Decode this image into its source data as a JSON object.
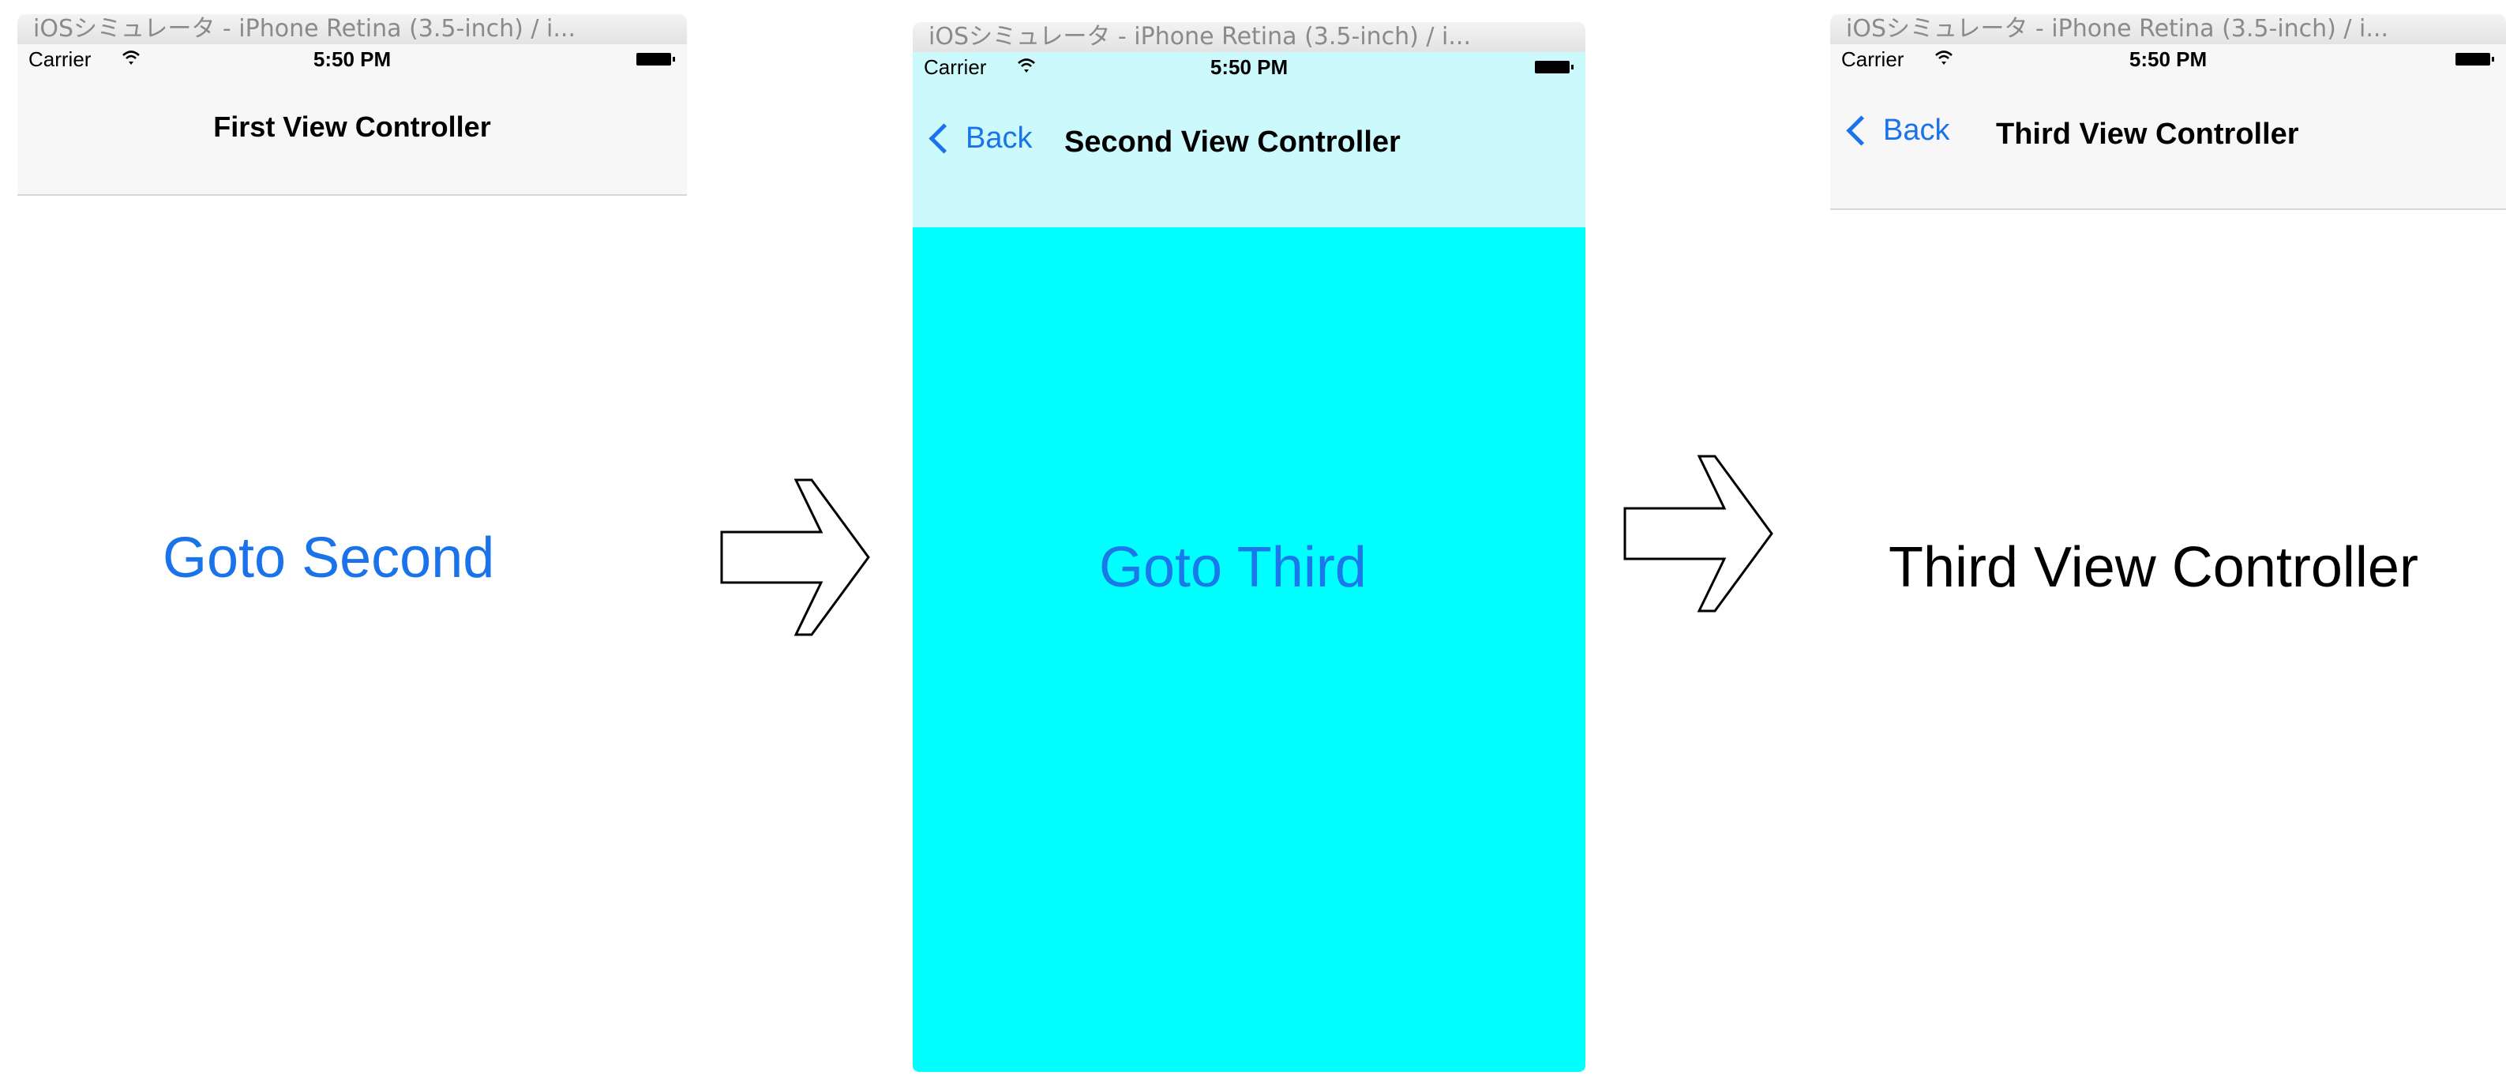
{
  "screens": [
    {
      "window_title": "iOSシミュレータ - iPhone Retina (3.5-inch) / i...",
      "carrier": "Carrier",
      "time": "5:50 PM",
      "nav_title": "First View Controller",
      "content_button": "Goto Second"
    },
    {
      "window_title": "iOSシミュレータ - iPhone Retina (3.5-inch) / i...",
      "carrier": "Carrier",
      "time": "5:50 PM",
      "back_label": "Back",
      "nav_title": "Second View Controller",
      "content_button": "Goto Third",
      "background_color": "#00ffff",
      "navbar_color": "#ccfafc"
    },
    {
      "window_title": "iOSシミュレータ - iPhone Retina (3.5-inch) / i...",
      "carrier": "Carrier",
      "time": "5:50 PM",
      "back_label": "Back",
      "nav_title": "Third View Controller",
      "content_label": "Third View Controller"
    }
  ],
  "icons": {
    "wifi": "wifi-icon",
    "battery": "battery-icon",
    "back": "chevron-left-icon",
    "flow_arrow": "right-arrow-icon"
  },
  "colors": {
    "accent": "#1a73e8",
    "cyan": "#00ffff"
  }
}
